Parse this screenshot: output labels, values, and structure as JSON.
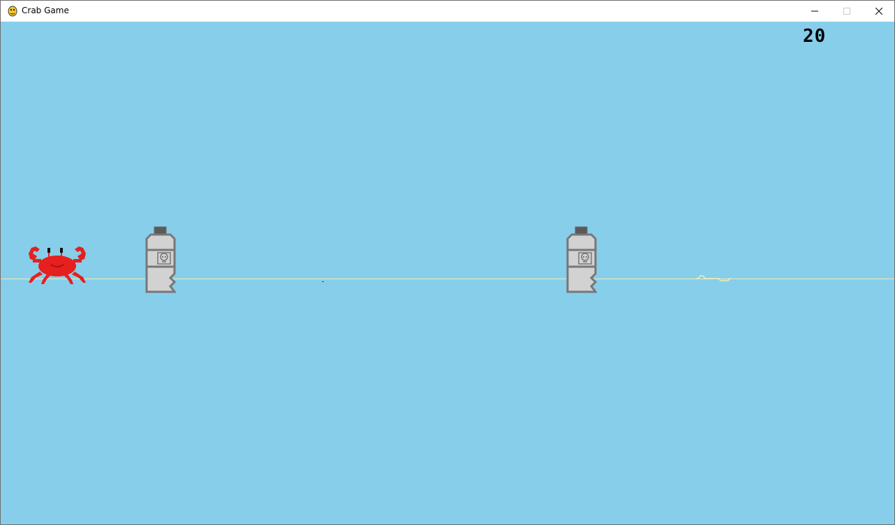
{
  "window": {
    "title": "Crab Game",
    "controls": [
      "minimize",
      "maximize",
      "close"
    ]
  },
  "game": {
    "score": "20",
    "background_color": "#87CEEA",
    "player": "crab",
    "obstacles": [
      "poison-bottle",
      "poison-bottle"
    ]
  },
  "icons": {
    "app": "pygame-snake-icon",
    "obstacle": "skull-icon"
  },
  "colors": {
    "crab": "#E61F1F",
    "bottle": "#D2D2D2",
    "bottle_outline": "#777777",
    "ground": "#F1ECB7"
  }
}
